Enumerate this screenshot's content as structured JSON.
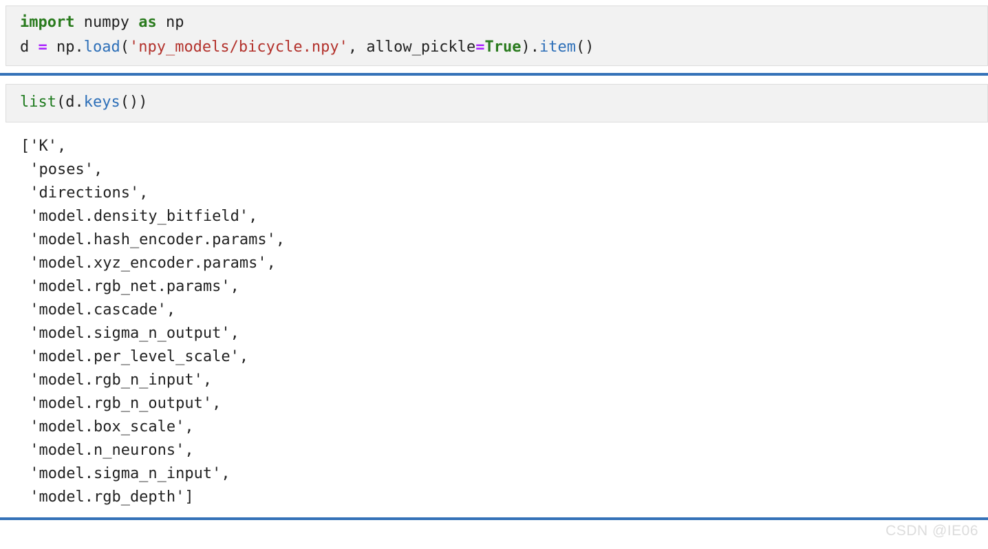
{
  "document": {
    "kind": "jupyter-notebook-screenshot",
    "watermark": "CSDN @IE06"
  },
  "colors": {
    "cell_background": "#f2f2f2",
    "cell_border": "#dddddd",
    "divider": "#3572b8",
    "keyword": "#2a7b1e",
    "function": "#2d6fb8",
    "string": "#b3322c",
    "operator": "#aa22ff",
    "text": "#222222",
    "watermark": "#dcdcdc"
  },
  "cells": [
    {
      "id": "cell-1",
      "type": "code",
      "lines": [
        {
          "id": "line-1",
          "tokens": [
            {
              "text": "import",
              "kind": "kw"
            },
            {
              "text": " numpy ",
              "kind": "plain"
            },
            {
              "text": "as",
              "kind": "kw"
            },
            {
              "text": " np",
              "kind": "plain"
            }
          ]
        },
        {
          "id": "line-2",
          "tokens": [
            {
              "text": "d ",
              "kind": "plain"
            },
            {
              "text": "=",
              "kind": "op"
            },
            {
              "text": " np.",
              "kind": "plain"
            },
            {
              "text": "load",
              "kind": "fn"
            },
            {
              "text": "(",
              "kind": "plain"
            },
            {
              "text": "'npy_models/bicycle.npy'",
              "kind": "str"
            },
            {
              "text": ", allow_pickle",
              "kind": "plain"
            },
            {
              "text": "=",
              "kind": "op"
            },
            {
              "text": "True",
              "kind": "bool"
            },
            {
              "text": ").",
              "kind": "plain"
            },
            {
              "text": "item",
              "kind": "fn"
            },
            {
              "text": "()",
              "kind": "plain"
            }
          ]
        }
      ]
    },
    {
      "id": "cell-2",
      "type": "code",
      "lines": [
        {
          "id": "line-1",
          "tokens": [
            {
              "text": "list",
              "kind": "builtin"
            },
            {
              "text": "(d.",
              "kind": "plain"
            },
            {
              "text": "keys",
              "kind": "fn"
            },
            {
              "text": "())",
              "kind": "plain"
            }
          ]
        }
      ]
    }
  ],
  "output": {
    "id": "output-1",
    "type": "text/plain",
    "lines": [
      "['K',",
      " 'poses',",
      " 'directions',",
      " 'model.density_bitfield',",
      " 'model.hash_encoder.params',",
      " 'model.xyz_encoder.params',",
      " 'model.rgb_net.params',",
      " 'model.cascade',",
      " 'model.sigma_n_output',",
      " 'model.per_level_scale',",
      " 'model.rgb_n_input',",
      " 'model.rgb_n_output',",
      " 'model.box_scale',",
      " 'model.n_neurons',",
      " 'model.sigma_n_input',",
      " 'model.rgb_depth']"
    ],
    "keys": [
      "K",
      "poses",
      "directions",
      "model.density_bitfield",
      "model.hash_encoder.params",
      "model.xyz_encoder.params",
      "model.rgb_net.params",
      "model.cascade",
      "model.sigma_n_output",
      "model.per_level_scale",
      "model.rgb_n_input",
      "model.rgb_n_output",
      "model.box_scale",
      "model.n_neurons",
      "model.sigma_n_input",
      "model.rgb_depth"
    ]
  }
}
